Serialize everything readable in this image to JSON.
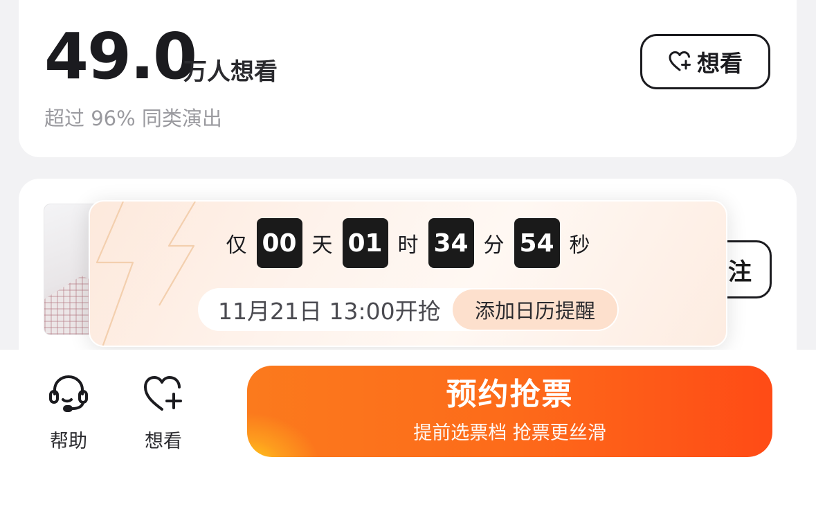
{
  "want_card": {
    "count": "49.0",
    "unit": "万人想看",
    "subtitle": "超过 96% 同类演出",
    "button_label": "想看"
  },
  "artist_card": {
    "follow_label_partial": "注"
  },
  "countdown": {
    "prefix": "仅",
    "days": "00",
    "days_unit": "天",
    "hours": "01",
    "hours_unit": "时",
    "minutes": "34",
    "minutes_unit": "分",
    "seconds": "54",
    "seconds_unit": "秒",
    "sale_time": "11月21日 13:00开抢",
    "reminder_label": "添加日历提醒"
  },
  "bottom_bar": {
    "help_label": "帮助",
    "want_label": "想看",
    "reserve_title": "预约抢票",
    "reserve_subtitle": "提前选票档 抢票更丝滑"
  },
  "colors": {
    "accent_orange": "#ff5a17",
    "accent_yellow": "#ffd21a",
    "reminder_bg": "#fde0cd"
  }
}
